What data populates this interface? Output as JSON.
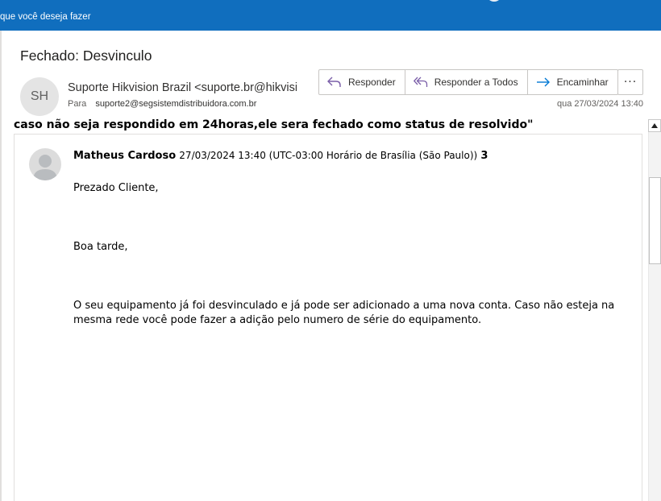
{
  "topbar": {
    "tell_me": "que você deseja fazer"
  },
  "message": {
    "subject": "Fechado: Desvinculo",
    "avatar_initials": "SH",
    "sender": "Suporte Hikvision Brazil <suporte.br@hikvision.com>",
    "to_label": "Para",
    "to_address": "suporte2@segsistemdistribuidora.com.br",
    "date": "qua 27/03/2024 13:40"
  },
  "actions": {
    "reply": "Responder",
    "reply_all": "Responder a Todos",
    "forward": "Encaminhar",
    "more": "···"
  },
  "body": {
    "bold_line": "caso não seja respondido em 24horas,ele sera fechado como status de resolvido\"",
    "reply_author": "Matheus Cardoso",
    "reply_meta": "27/03/2024 13:40 (UTC-03:00 Horário de Brasília (São Paulo))",
    "reply_number": "3",
    "greeting": "Prezado Cliente,",
    "afternoon": "Boa tarde,",
    "paragraph": "O seu equipamento já foi desvinculado e já pode ser adicionado a uma nova conta. Caso não esteja na mesma rede você pode fazer a adição pelo numero de série do equipamento."
  },
  "colors": {
    "accent": "#106ebe",
    "reply_icon": "#7a5ea8",
    "forward_icon": "#0078d4"
  }
}
